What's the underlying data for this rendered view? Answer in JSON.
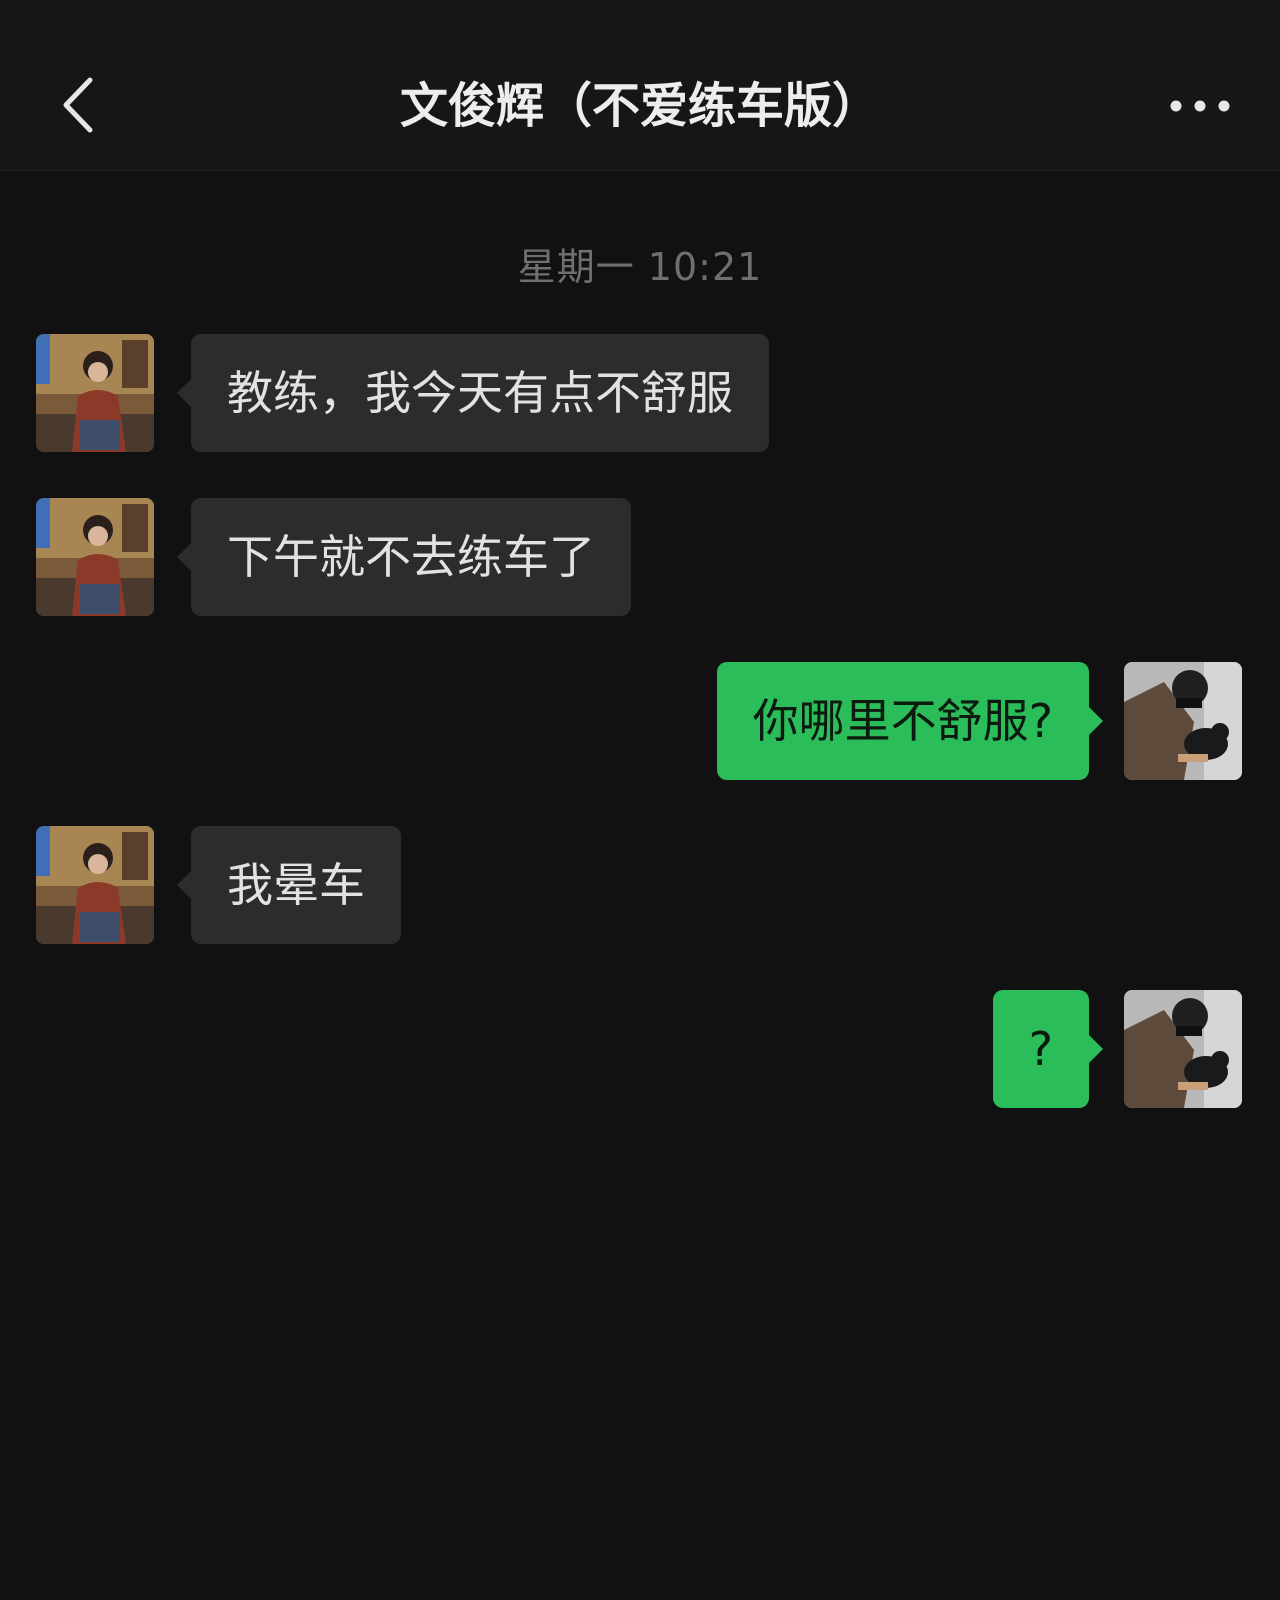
{
  "header": {
    "title": "文俊辉（不爱练车版）",
    "back_icon": "chevron-left-icon",
    "more_icon": "more-dots-icon"
  },
  "chat": {
    "timestamp": "星期一 10:21",
    "messages": [
      {
        "direction": "incoming",
        "text": "教练，我今天有点不舒服"
      },
      {
        "direction": "incoming",
        "text": "下午就不去练车了"
      },
      {
        "direction": "outgoing",
        "text": "你哪里不舒服?"
      },
      {
        "direction": "incoming",
        "text": "我晕车"
      },
      {
        "direction": "outgoing",
        "text": "?"
      }
    ]
  },
  "colors": {
    "background": "#111111",
    "incoming_bubble": "#2c2c2c",
    "outgoing_bubble": "#2bbd59",
    "timestamp_text": "#6f6f6f"
  }
}
